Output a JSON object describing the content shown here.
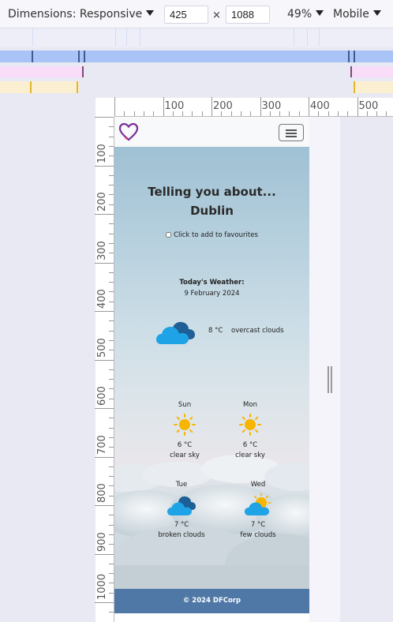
{
  "devtools": {
    "dimensions_label": "Dimensions: Responsive",
    "width_value": "425",
    "height_value": "1088",
    "times": "×",
    "zoom": "49%",
    "device_type": "Mobile",
    "ruler_h_labels": [
      "100",
      "200",
      "300",
      "400",
      "500"
    ],
    "ruler_v_labels": [
      "100",
      "200",
      "300",
      "400",
      "500",
      "600",
      "700",
      "800",
      "900",
      "1000"
    ],
    "media_query_colors": {
      "max_width": "#a9c3f7",
      "min_width": "#f9dcf8",
      "range": "#fbefd1"
    }
  },
  "site": {
    "logo_icon": "heart-logo-icon",
    "menu_icon": "hamburger-icon",
    "title_line1": "Telling you about...",
    "title_line2": "Dublin",
    "favourite_label": "Click to add to favourites",
    "today_label": "Today's Weather:",
    "today_date": "9 February 2024",
    "current": {
      "temp": "8 °C",
      "desc": "overcast clouds",
      "icon": "overcast-clouds-icon"
    },
    "forecast": [
      {
        "day": "Sun",
        "temp": "6 °C",
        "desc": "clear sky",
        "icon": "sun-icon"
      },
      {
        "day": "Mon",
        "temp": "6 °C",
        "desc": "clear sky",
        "icon": "sun-icon"
      },
      {
        "day": "Tue",
        "temp": "7 °C",
        "desc": "broken clouds",
        "icon": "broken-clouds-icon"
      },
      {
        "day": "Wed",
        "temp": "7 °C",
        "desc": "few clouds",
        "icon": "few-clouds-icon"
      }
    ],
    "footer": "© 2024 DFCorp",
    "colors": {
      "footer": "#4f78a6",
      "cloud_blue": "#1ea3e6",
      "cloud_dark": "#1d5f96",
      "sun": "#f7b500"
    }
  }
}
